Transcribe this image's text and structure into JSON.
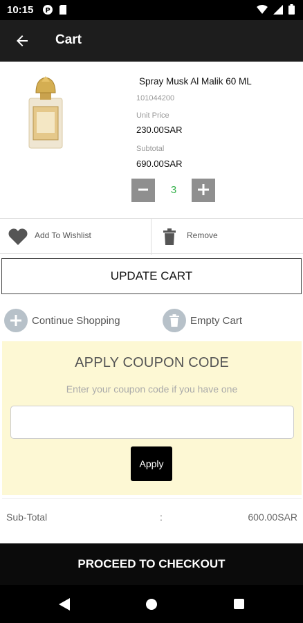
{
  "status_bar": {
    "time": "10:15",
    "icons": [
      "notification-p-icon",
      "sim-card-icon",
      "wifi-icon",
      "signal-icon",
      "battery-icon"
    ]
  },
  "app_bar": {
    "title": "Cart",
    "back_icon": "arrow-left-icon"
  },
  "cart_item": {
    "name": "Spray Musk Al Malik 60 ML",
    "sku": "101044200",
    "unit_price_label": "Unit Price",
    "unit_price": "230.00SAR",
    "subtotal_label": "Subtotal",
    "subtotal": "690.00SAR",
    "quantity": "3"
  },
  "actions": {
    "wishlist_label": "Add To Wishlist",
    "remove_label": "Remove"
  },
  "update_cart_label": "UPDATE CART",
  "links": {
    "continue_label": "Continue Shopping",
    "empty_label": "Empty Cart"
  },
  "coupon": {
    "title": "APPLY COUPON CODE",
    "subtitle": "Enter your coupon code if you have one",
    "input_value": "",
    "apply_label": "Apply"
  },
  "totals": {
    "subtotal_label": "Sub-Total",
    "separator": ":",
    "subtotal_value": "600.00SAR"
  },
  "checkout_label": "PROCEED TO CHECKOUT",
  "colors": {
    "app_bar": "#1d1d1d",
    "coupon_bg": "#fdf8d4",
    "qty_text": "#37b24d",
    "qty_button": "#8f8f8f"
  }
}
